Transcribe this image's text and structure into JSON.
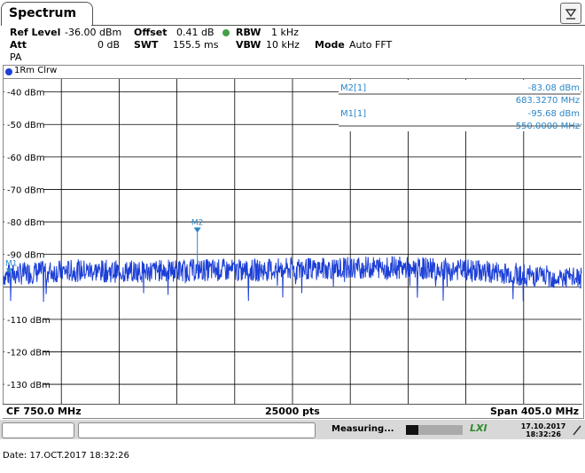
{
  "tab": {
    "label": "Spectrum"
  },
  "header": {
    "ref_level_label": "Ref Level",
    "ref_level_value": "-36.00 dBm",
    "offset_label": "Offset",
    "offset_value": "0.41 dB",
    "rbw_label": "RBW",
    "rbw_value": "1 kHz",
    "att_label": "Att",
    "att_value": "0 dB",
    "swt_label": "SWT",
    "swt_value": "155.5 ms",
    "vbw_label": "VBW",
    "vbw_value": "10 kHz",
    "mode_label": "Mode",
    "mode_value": "Auto FFT",
    "pa_label": "PA"
  },
  "trace": {
    "label": "1Rm Clrw",
    "color": "#1c3fd6"
  },
  "markers": {
    "m2_label": "M2[1]",
    "m2_level": "-83.08 dBm",
    "m2_freq": "683.3270 MHz",
    "m1_label": "M1[1]",
    "m1_level": "-95.68 dBm",
    "m1_freq": "550.0000 MHz",
    "m2_tag": "M2",
    "m1_tag": "M1",
    "color": "#2a86c8"
  },
  "footer": {
    "cf": "CF 750.0 MHz",
    "pts": "25000 pts",
    "span": "Span 405.0 MHz"
  },
  "status": {
    "measuring": "Measuring...",
    "lxi": "LXI",
    "date": "17.10.2017",
    "time": "18:32:26"
  },
  "page_footer": "Date: 17.OCT.2017  18:32:26",
  "chart_data": {
    "type": "line",
    "title": "",
    "xlabel": "",
    "ylabel": "",
    "x_center_mhz": 750.0,
    "x_span_mhz": 405.0,
    "xlim": [
      547.5,
      952.5
    ],
    "ylim": [
      -136,
      -36
    ],
    "y_ticks": [
      -40,
      -50,
      -60,
      -70,
      -80,
      -90,
      -110,
      -120,
      -130
    ],
    "y_tick_labels": [
      "-40 dBm",
      "-50 dBm",
      "-60 dBm",
      "-70 dBm",
      "-80 dBm",
      "-90 dBm",
      "-110 dBm",
      "-120 dBm",
      "-130 dBm"
    ],
    "grid": true,
    "series": [
      {
        "x": [
          547.5,
          570,
          600,
          630,
          660,
          690,
          720,
          750,
          780,
          810,
          840,
          870,
          900,
          930,
          952.5
        ],
        "values": [
          -96.5,
          -95.5,
          -95.0,
          -95.3,
          -95.0,
          -94.8,
          -95.0,
          -94.5,
          -94.3,
          -94.0,
          -94.3,
          -94.8,
          -95.8,
          -97.0,
          -97.5
        ]
      }
    ],
    "markers": [
      {
        "name": "M2",
        "x": 683.327,
        "y": -83.08
      },
      {
        "name": "M1",
        "x": 550.0,
        "y": -95.68
      }
    ]
  }
}
